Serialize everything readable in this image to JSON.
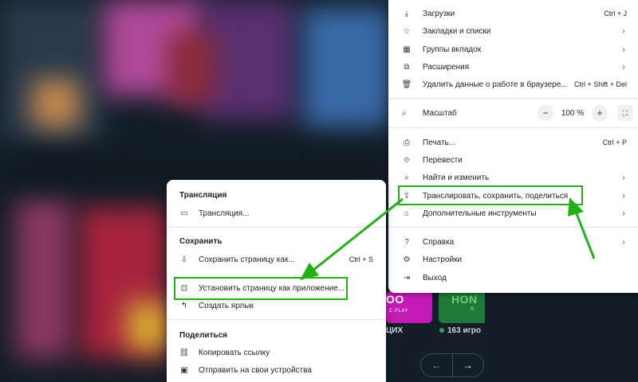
{
  "background": {
    "tile1_title": "OO",
    "tile1_sub": "C PLAY",
    "tile2_title": "HON",
    "tile2_sub": "R",
    "below_left": "ЦИХ",
    "below_right": "163 игро",
    "pager_prev": "←",
    "pager_next": "→"
  },
  "main_menu": {
    "items_top": [
      {
        "icon": "download-icon",
        "glyph": "⤓",
        "label": "Загрузки",
        "shortcut": "Ctrl + J",
        "arrow": ""
      },
      {
        "icon": "star-icon",
        "glyph": "☆",
        "label": "Закладки и списки",
        "shortcut": "",
        "arrow": "›"
      },
      {
        "icon": "tab-groups-icon",
        "glyph": "▦",
        "label": "Группы вкладок",
        "shortcut": "",
        "arrow": "›"
      },
      {
        "icon": "extension-icon",
        "glyph": "⧉",
        "label": "Расширения",
        "shortcut": "",
        "arrow": "›"
      },
      {
        "icon": "trash-icon",
        "glyph": "🗑",
        "label": "Удалить данные о работе в браузере...",
        "shortcut": "Ctrl + Shift + Del",
        "arrow": ""
      }
    ],
    "zoom": {
      "label": "Масштаб",
      "minus": "−",
      "value": "100 %",
      "plus": "+",
      "fullscreen": "⛶"
    },
    "items_mid": [
      {
        "icon": "print-icon",
        "glyph": "⎙",
        "label": "Печать...",
        "shortcut": "Ctrl + P",
        "arrow": ""
      },
      {
        "icon": "translate-icon",
        "glyph": "⟐",
        "label": "Перевести",
        "shortcut": "",
        "arrow": ""
      },
      {
        "icon": "find-icon",
        "glyph": "⌕",
        "label": "Найти и изменить",
        "shortcut": "",
        "arrow": "›"
      },
      {
        "icon": "cast-save-share-icon",
        "glyph": "⇪",
        "label": "Транслировать, сохранить, поделиться",
        "shortcut": "",
        "arrow": "›"
      },
      {
        "icon": "toolbox-icon",
        "glyph": "⌂",
        "label": "Дополнительные инструменты",
        "shortcut": "",
        "arrow": "›"
      }
    ],
    "items_bottom": [
      {
        "icon": "help-icon",
        "glyph": "?",
        "label": "Справка",
        "shortcut": "",
        "arrow": "›"
      },
      {
        "icon": "settings-icon",
        "glyph": "⚙",
        "label": "Настройки",
        "shortcut": "",
        "arrow": ""
      },
      {
        "icon": "exit-icon",
        "glyph": "⇥",
        "label": "Выход",
        "shortcut": "",
        "arrow": ""
      }
    ]
  },
  "sub_menu": {
    "section_cast": "Трансляция",
    "cast_item": {
      "glyph": "▭",
      "label": "Трансляция..."
    },
    "section_save": "Сохранить",
    "save_page": {
      "glyph": "⇩",
      "label": "Сохранить страницу как...",
      "shortcut": "Ctrl + S"
    },
    "install_app": {
      "glyph": "⊡",
      "label": "Установить страницу как приложение..."
    },
    "create_shortcut": {
      "glyph": "↰",
      "label": "Создать ярлык"
    },
    "section_share": "Поделиться",
    "copy_link": {
      "glyph": "⛓",
      "label": "Копировать ссылку"
    },
    "send_devices": {
      "glyph": "▣",
      "label": "Отправить на свои устройства"
    }
  },
  "colors": {
    "highlight": "#22b014",
    "menu_bg": "#ffffff"
  }
}
